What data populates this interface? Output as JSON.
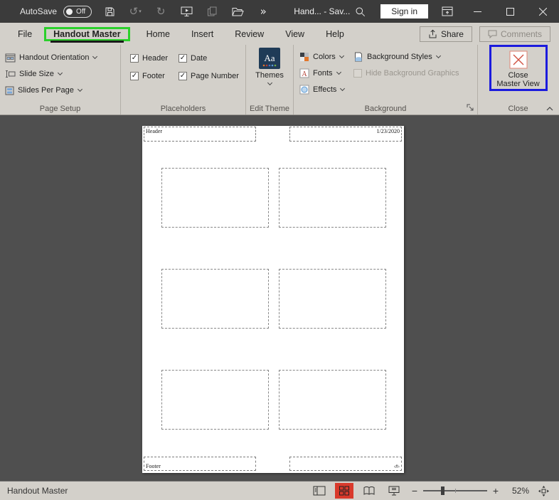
{
  "titlebar": {
    "autosave_label": "AutoSave",
    "autosave_state": "Off",
    "doc_title": "Hand... - Sav...",
    "sign_in_label": "Sign in"
  },
  "tab_row": {
    "tabs": [
      {
        "label": "File",
        "active": false
      },
      {
        "label": "Handout Master",
        "active": true
      },
      {
        "label": "Home",
        "active": false
      },
      {
        "label": "Insert",
        "active": false
      },
      {
        "label": "Review",
        "active": false
      },
      {
        "label": "View",
        "active": false
      },
      {
        "label": "Help",
        "active": false
      }
    ],
    "share_label": "Share",
    "comments_label": "Comments"
  },
  "ribbon": {
    "page_setup": {
      "group_label": "Page Setup",
      "items": [
        {
          "label": "Handout Orientation"
        },
        {
          "label": "Slide Size"
        },
        {
          "label": "Slides Per Page"
        }
      ]
    },
    "placeholders": {
      "group_label": "Placeholders",
      "checkboxes": [
        {
          "label": "Header",
          "checked": true
        },
        {
          "label": "Date",
          "checked": true
        },
        {
          "label": "Footer",
          "checked": true
        },
        {
          "label": "Page Number",
          "checked": true
        }
      ]
    },
    "edit_theme": {
      "group_label": "Edit Theme",
      "themes_label": "Themes",
      "themes_icon_text": "Aa"
    },
    "background": {
      "group_label": "Background",
      "colors_label": "Colors",
      "fonts_label": "Fonts",
      "effects_label": "Effects",
      "bg_styles_label": "Background Styles",
      "hide_bg_label": "Hide Background Graphics"
    },
    "close": {
      "group_label": "Close",
      "button_line1": "Close",
      "button_line2": "Master View"
    }
  },
  "slide_area": {
    "header_text": "Header",
    "date_text": "1/23/2020",
    "footer_text": "Footer",
    "page_number_text": "‹#›"
  },
  "status_bar": {
    "view_label": "Handout Master",
    "zoom_minus": "−",
    "zoom_plus": "+",
    "zoom_level": "52%"
  },
  "glyphs": {
    "checkmark": "✓",
    "undo_arrow": "↺",
    "redo_arrow": "↻",
    "overflow_chevron": "»"
  },
  "annotation_colors": {
    "tab_highlight": "#2bd02b",
    "close_highlight": "#1b1bdd",
    "view_highlight": "#d93a2c"
  }
}
